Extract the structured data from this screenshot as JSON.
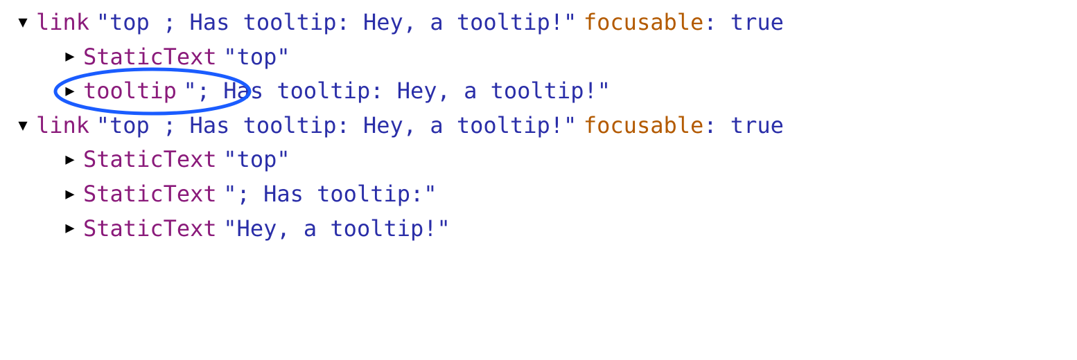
{
  "tree": {
    "link1": {
      "disclosure": "▼",
      "role": "link",
      "name": "\"top ; Has tooltip: Hey, a tooltip!\"",
      "attr_name": "focusable",
      "attr_value": ": true",
      "child1": {
        "disclosure": "▶",
        "role": "StaticText",
        "name": "\"top\""
      },
      "child2": {
        "disclosure": "▶",
        "role": "tooltip",
        "name": "\"; Has tooltip: Hey, a tooltip!\""
      }
    },
    "link2": {
      "disclosure": "▼",
      "role": "link",
      "name": "\"top ; Has tooltip: Hey, a tooltip!\"",
      "attr_name": "focusable",
      "attr_value": ": true",
      "child1": {
        "disclosure": "▶",
        "role": "StaticText",
        "name": "\"top\""
      },
      "child2": {
        "disclosure": "▶",
        "role": "StaticText",
        "name": "\"; Has tooltip:\""
      },
      "child3": {
        "disclosure": "▶",
        "role": "StaticText",
        "name": "\"Hey, a tooltip!\""
      }
    }
  }
}
